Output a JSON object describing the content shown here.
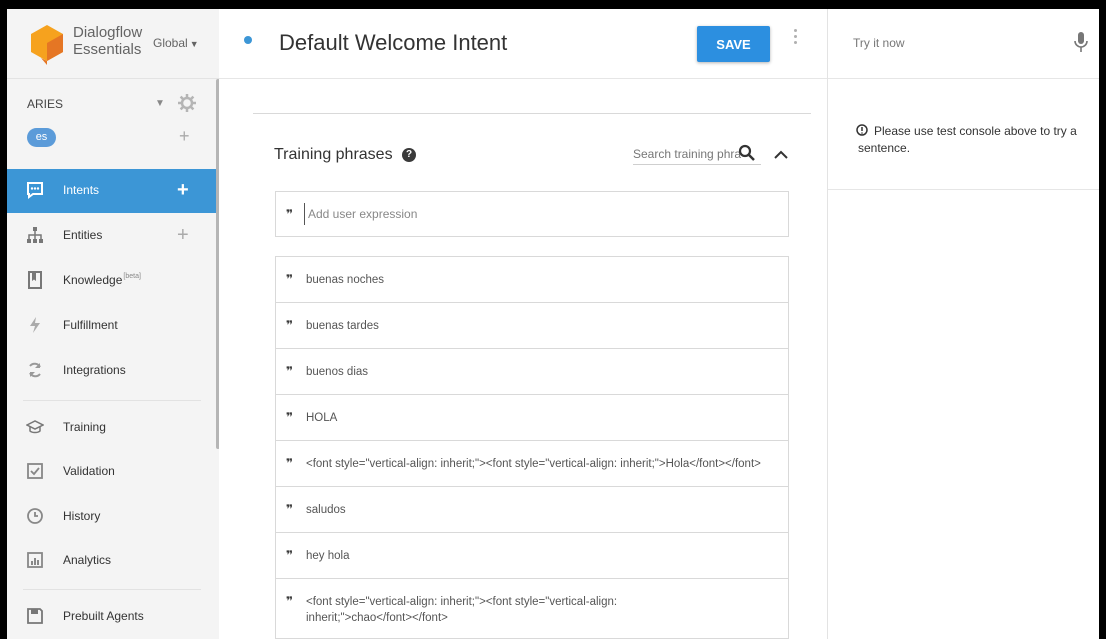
{
  "brand": {
    "line1": "Dialogflow",
    "line2": "Essentials",
    "region": "Global",
    "colors": {
      "logo_light": "#f6a21e",
      "logo_dark": "#e57624"
    }
  },
  "agent": {
    "name": "ARIES",
    "language": "es"
  },
  "nav": {
    "primary": [
      {
        "label": "Intents",
        "icon": "intents-icon",
        "active": true,
        "has_add": true
      },
      {
        "label": "Entities",
        "icon": "entities-icon",
        "active": false,
        "has_add": true
      },
      {
        "label": "Knowledge",
        "badge": "[beta]",
        "icon": "knowledge-icon",
        "active": false
      },
      {
        "label": "Fulfillment",
        "icon": "fulfillment-icon",
        "active": false
      },
      {
        "label": "Integrations",
        "icon": "integrations-icon",
        "active": false
      }
    ],
    "secondary": [
      {
        "label": "Training",
        "icon": "training-icon"
      },
      {
        "label": "Validation",
        "icon": "validation-icon"
      },
      {
        "label": "History",
        "icon": "history-icon"
      },
      {
        "label": "Analytics",
        "icon": "analytics-icon"
      }
    ],
    "tertiary": [
      {
        "label": "Prebuilt Agents",
        "icon": "prebuilt-agents-icon"
      }
    ],
    "active_color": "#3c96d6"
  },
  "header": {
    "title": "Default Welcome Intent",
    "save_label": "SAVE"
  },
  "training": {
    "title": "Training phrases",
    "search_placeholder": "Search training phra",
    "add_placeholder": "Add user expression",
    "phrases": [
      "buenas noches",
      "buenas tardes",
      "buenos dias",
      "HOLA",
      "<font style=\"vertical-align: inherit;\"><font style=\"vertical-align: inherit;\">Hola</font></font>",
      "saludos",
      "hey hola",
      "<font style=\"vertical-align: inherit;\"><font style=\"vertical-align: inherit;\">chao</font></font>"
    ]
  },
  "console": {
    "try_placeholder": "Try it now",
    "message": "Please use test console above to try a sentence."
  }
}
